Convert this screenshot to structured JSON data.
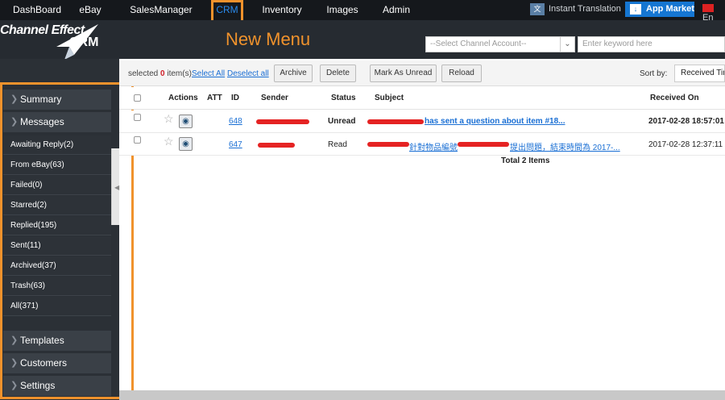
{
  "nav": {
    "items": [
      "DashBoard",
      "eBay",
      "SalesManager",
      "CRM",
      "Inventory",
      "Images",
      "Admin"
    ],
    "active": "CRM",
    "instant_translation": "Instant Translation",
    "app_market": "App Market",
    "language": "En"
  },
  "header": {
    "logo_text": "Channel Effect",
    "logo_sub": "CRM",
    "annotation": "New Menu",
    "channel_placeholder": "--Select Channel Account--",
    "keyword_placeholder": "Enter keyword here"
  },
  "sidebar": {
    "sections": {
      "summary": "Summary",
      "messages": "Messages",
      "templates": "Templates",
      "customers": "Customers",
      "settings": "Settings"
    },
    "items": [
      "Awaiting Reply(2)",
      "From eBay(63)",
      "Failed(0)",
      "Starred(2)",
      "Replied(195)",
      "Sent(11)",
      "Archived(37)",
      "Trash(63)",
      "All(371)"
    ]
  },
  "toolbar": {
    "selected_prefix": "selected",
    "selected_count": "0",
    "selected_suffix": "item(s)",
    "select_all": "Select All",
    "deselect_all": "Deselect all",
    "archive": "Archive",
    "delete": "Delete",
    "mark_unread": "Mark As Unread",
    "reload": "Reload",
    "sort_by": "Sort by:",
    "sort_value": "Received Time"
  },
  "table": {
    "headers": {
      "actions": "Actions",
      "att": "ATT",
      "id": "ID",
      "sender": "Sender",
      "status": "Status",
      "subject": "Subject",
      "received": "Received On"
    },
    "rows": [
      {
        "id": "648",
        "status": "Unread",
        "subject": "has sent a question about item #18...",
        "received": "2017-02-28 18:57:01"
      },
      {
        "id": "647",
        "status": "Read",
        "subject_a": "針對物品編號",
        "subject_b": "提出問題，結束時間為 2017-...",
        "received": "2017-02-28 12:37:11"
      }
    ],
    "total": "Total 2 Items"
  },
  "colors": {
    "accent": "#f0922c",
    "active_nav": "#2a8cf0",
    "redaction": "#e52323"
  }
}
